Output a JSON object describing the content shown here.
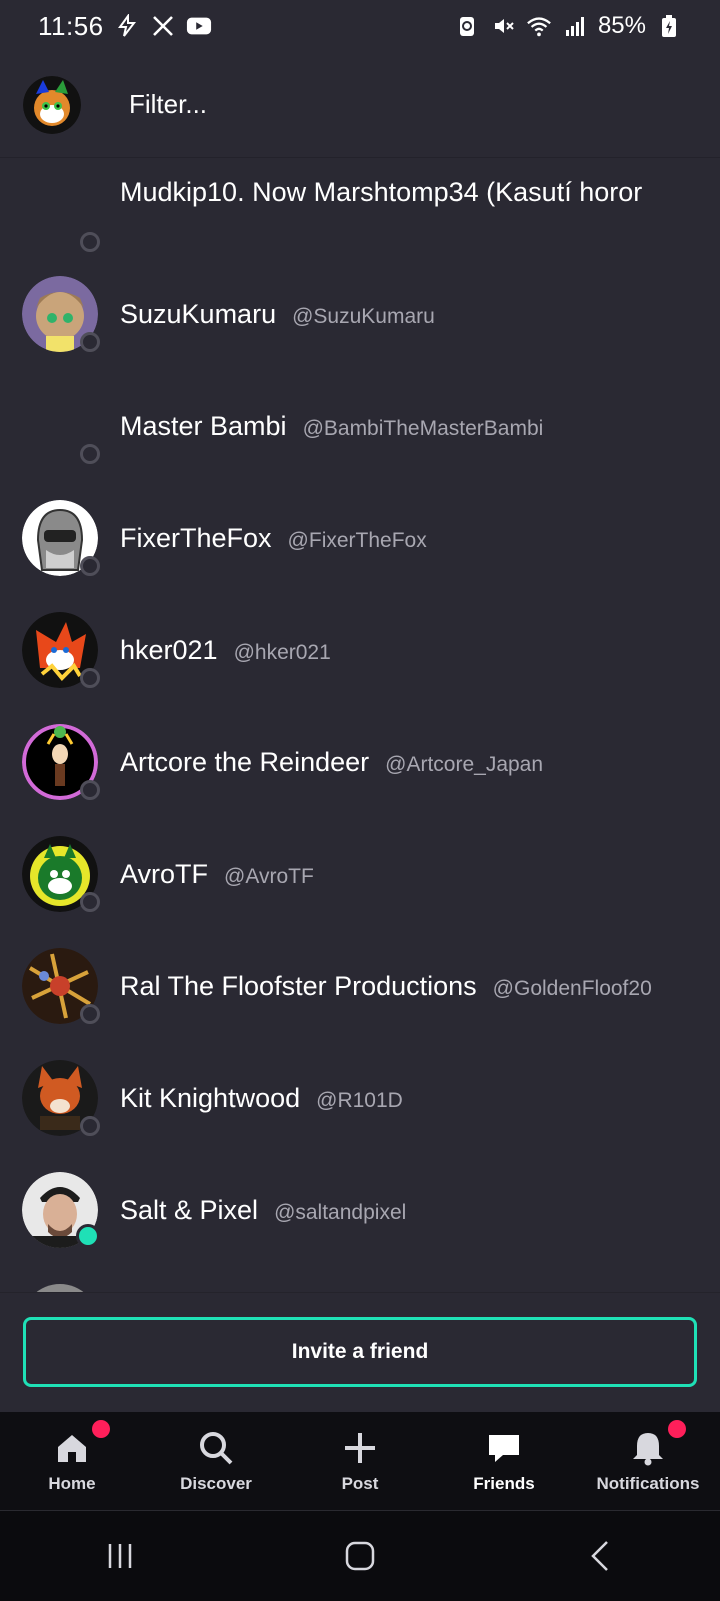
{
  "status_bar": {
    "time": "11:56",
    "battery": "85%",
    "icons_left": [
      "flash-icon",
      "x-icon",
      "youtube-icon"
    ],
    "icons_right": [
      "battery-saver-icon",
      "mute-icon",
      "wifi-icon",
      "signal-icon",
      "battery-icon"
    ]
  },
  "header": {
    "filter_placeholder": "Filter..."
  },
  "friends": [
    {
      "name": "Mudkip10.  Now Marshtomp34 (Kasutí horor",
      "handle": "",
      "online": false
    },
    {
      "name": "SuzuKumaru",
      "handle": "@SuzuKumaru",
      "online": false
    },
    {
      "name": "Master Bambi",
      "handle": "@BambiTheMasterBambi",
      "online": false
    },
    {
      "name": "FixerTheFox",
      "handle": "@FixerTheFox",
      "online": false
    },
    {
      "name": "hker021",
      "handle": "@hker021",
      "online": false
    },
    {
      "name": "Artcore the Reindeer",
      "handle": "@Artcore_Japan",
      "online": false
    },
    {
      "name": "AvroTF",
      "handle": "@AvroTF",
      "online": false
    },
    {
      "name": "Ral The Floofster Productions",
      "handle": "@GoldenFloof20",
      "online": false
    },
    {
      "name": "Kit Knightwood",
      "handle": "@R101D",
      "online": false
    },
    {
      "name": "Salt & Pixel",
      "handle": "@saltandpixel",
      "online": true
    }
  ],
  "invite": {
    "label": "Invite a friend"
  },
  "nav": [
    {
      "label": "Home",
      "icon": "home-icon",
      "badge": true,
      "active": false
    },
    {
      "label": "Discover",
      "icon": "search-icon",
      "badge": false,
      "active": false
    },
    {
      "label": "Post",
      "icon": "plus-icon",
      "badge": false,
      "active": false
    },
    {
      "label": "Friends",
      "icon": "chat-icon",
      "badge": false,
      "active": true
    },
    {
      "label": "Notifications",
      "icon": "bell-icon",
      "badge": true,
      "active": false
    }
  ],
  "colors": {
    "background": "#2a2933",
    "accent": "#1fe0b6",
    "badge": "#ff1f5a",
    "nav_bg": "#0e0e12"
  }
}
